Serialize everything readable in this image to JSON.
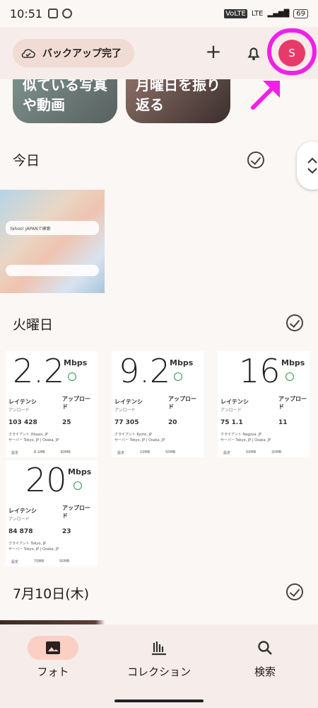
{
  "status_bar": {
    "time": "10:51",
    "network": "VoLTE",
    "lte": "LTE",
    "battery": "69"
  },
  "header": {
    "backup_label": "バックアップ完了",
    "add_icon": "plus-icon",
    "notification_icon": "bell-icon",
    "avatar_letter": "S",
    "highlight_color": "#f21fe8"
  },
  "memories": [
    {
      "text": "似ている写真や動画"
    },
    {
      "text": "月曜日を振り返る"
    }
  ],
  "sections": {
    "today": "今日",
    "tuesday": "火曜日",
    "july10": "7月10日(木)"
  },
  "photo": {
    "search_bar": "Yahoo! JAPANで検索"
  },
  "speedtests": [
    {
      "value": "2.2",
      "unit": "Mbps",
      "latency": "レイテンシ",
      "upload": "アップロード",
      "download_label": "アンロード",
      "sub": "読み  ロード読み",
      "v1": "103",
      "v2": "428",
      "upload_value": "25",
      "client": "クライアント Okaasi, JP",
      "server": "サーバー Tokyo, JP | Osaka, JP",
      "f1": "設定",
      "f2": "8.1MB",
      "f3": "60MB"
    },
    {
      "value": "9.2",
      "unit": "Mbps",
      "latency": "レイテンシ",
      "upload": "アップロード",
      "download_label": "アンロード",
      "sub": "読み  ロード読み",
      "v1": "77",
      "v2": "305",
      "upload_value": "20",
      "client": "クライアント Kyoto, JP",
      "server": "サーバー Tokyo, JP | Osaka, JP",
      "f1": "設定",
      "f2": "10MB",
      "f3": "50MB"
    },
    {
      "value": "16",
      "unit": "Mbps",
      "latency": "レイテンシ",
      "upload": "アップロード",
      "download_label": "アンロード",
      "sub": "読み  ロード読み",
      "v1": "75",
      "v2": "1.1",
      "upload_value": "11",
      "client": "クライアント Nagoya, JP",
      "server": "サーバー Tokyo, JP | Osaka, JP",
      "f1": "設定",
      "f2": "50MB",
      "f3": "20MB"
    },
    {
      "value": "20",
      "unit": "Mbps",
      "latency": "レイテンシ",
      "upload": "アップロード",
      "download_label": "アンロード",
      "sub": "読み  ロード読み",
      "v1": "84",
      "v2": "878",
      "upload_value": "23",
      "client": "クライアント Tokyo, JP",
      "server": "サーバー Tokyo, JP | Osaka, JP",
      "f1": "設定",
      "f2": "70MB",
      "f3": "50MB"
    }
  ],
  "bottom_nav": [
    {
      "label": "フォト",
      "icon": "photo-icon",
      "active": true
    },
    {
      "label": "コレクション",
      "icon": "collection-icon",
      "active": false
    },
    {
      "label": "検索",
      "icon": "search-icon",
      "active": false
    }
  ]
}
